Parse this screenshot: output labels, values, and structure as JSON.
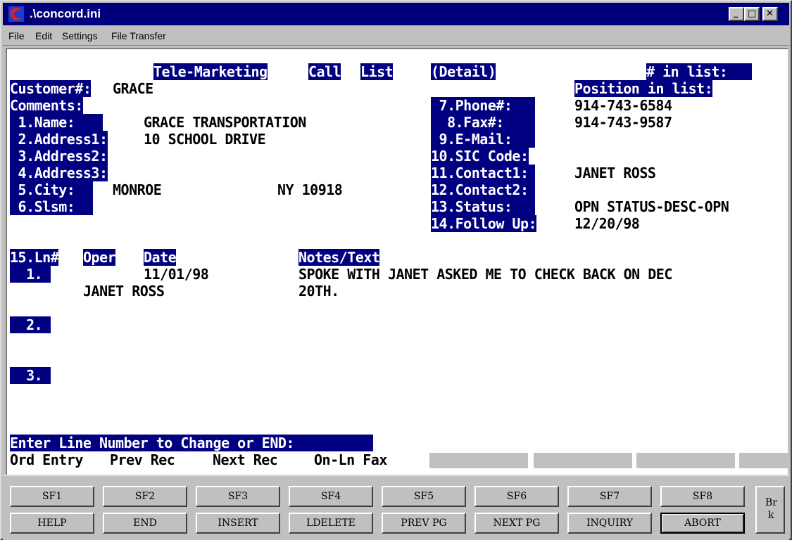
{
  "window": {
    "title": ".\\concord.ini",
    "controls": {
      "minimize": "_",
      "maximize": "□",
      "close": "✕"
    }
  },
  "menu": [
    "File",
    "Edit",
    "Settings",
    "File Transfer"
  ],
  "screen": {
    "heading": {
      "part1": "Tele-Marketing",
      "part2": "Call",
      "part3": "List",
      "part4": "(Detail)"
    },
    "in_list_label": "# in list:",
    "position_label": "Position in list:",
    "customer_label": "Customer#:",
    "customer_value": "GRACE",
    "comments_label": "Comments:",
    "fields_left": [
      {
        "label": " 1.Name:",
        "value": "GRACE TRANSPORTATION"
      },
      {
        "label": " 2.Address1:",
        "value": "10 SCHOOL DRIVE"
      },
      {
        "label": " 3.Address2:",
        "value": ""
      },
      {
        "label": " 4.Address3:",
        "value": ""
      },
      {
        "label": " 5.City:",
        "value": "MONROE",
        "state_zip": "NY 10918"
      },
      {
        "label": " 6.Slsm:",
        "value": ""
      }
    ],
    "fields_right": [
      {
        "label": " 7.Phone#:",
        "value": "914-743-6584"
      },
      {
        "label": "  8.Fax#:",
        "value": "914-743-9587"
      },
      {
        "label": " 9.E-Mail:",
        "value": ""
      },
      {
        "label": "10.SIC Code:",
        "value": ""
      },
      {
        "label": "11.Contact1:",
        "value": "JANET ROSS"
      },
      {
        "label": "12.Contact2:",
        "value": ""
      },
      {
        "label": "13.Status:",
        "value": "OPN STATUS-DESC-OPN"
      },
      {
        "label": "14.Follow Up:",
        "value": "12/20/98"
      }
    ],
    "lines_header": {
      "ln": "15.Ln#",
      "oper": "Oper",
      "date": "Date",
      "notes": "Notes/Text"
    },
    "lines": [
      {
        "num": "  1.",
        "date": "11/01/98",
        "oper": "JANET ROSS",
        "notes1": "SPOKE WITH JANET ASKED ME TO CHECK BACK ON DEC",
        "notes2": "20TH."
      },
      {
        "num": "  2."
      },
      {
        "num": "  3."
      }
    ],
    "prompt": "Enter Line Number to Change or END:",
    "softkeys": [
      "Ord Entry",
      "Prev Rec",
      "Next Rec",
      "On-Ln Fax"
    ]
  },
  "function_keys": {
    "row1": [
      "SF1",
      "SF2",
      "SF3",
      "SF4",
      "SF5",
      "SF6",
      "SF7",
      "SF8"
    ],
    "row2": [
      "HELP",
      "END",
      "INSERT",
      "LDELETE",
      "PREV PG",
      "NEXT PG",
      "INQUIRY",
      "ABORT"
    ],
    "break_top": "Br",
    "break_bottom": "k"
  }
}
